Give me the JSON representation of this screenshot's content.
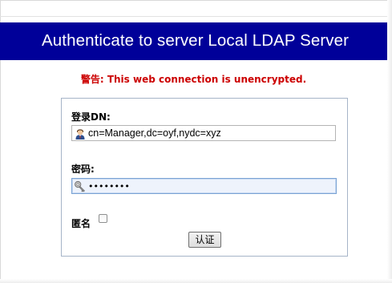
{
  "header": {
    "title": "Authenticate to server Local LDAP Server"
  },
  "warning": {
    "text": "警告: This web connection is unencrypted."
  },
  "form": {
    "dn_label": "登录DN:",
    "dn_value": "cn=Manager,dc=oyf,nydc=xyz",
    "dn_icon": "user-icon",
    "password_label": "密码:",
    "password_mask": "••••••••",
    "password_icon": "key-icon",
    "anonymous_label": "匿名",
    "anonymous_checked": false,
    "submit_label": "认证"
  },
  "colors": {
    "header_bg": "#000099",
    "header_text": "#ffffff",
    "warning_text": "#cc0000",
    "panel_border": "#a6b4c8"
  }
}
